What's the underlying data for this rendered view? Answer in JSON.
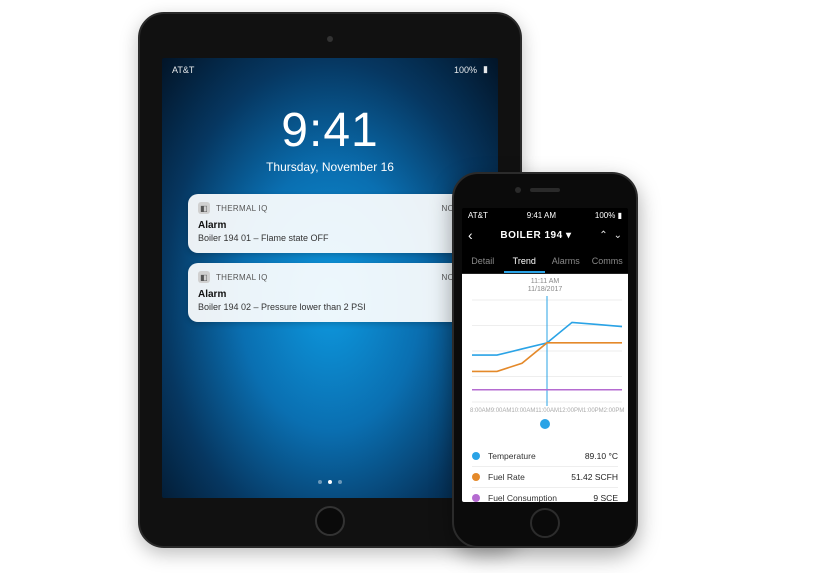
{
  "ipad": {
    "status_carrier": "AT&T",
    "status_battery": "100%",
    "clock_time": "9:41",
    "clock_date": "Thursday, November 16",
    "notifications": [
      {
        "app": "THERMAL IQ",
        "when": "now",
        "title": "Alarm",
        "body": "Boiler 194 01 – Flame state OFF"
      },
      {
        "app": "THERMAL IQ",
        "when": "now",
        "title": "Alarm",
        "body": "Boiler 194 02 – Pressure lower than 2 PSI"
      }
    ]
  },
  "phone": {
    "status_carrier": "AT&T",
    "status_time": "9:41 AM",
    "status_battery": "100%",
    "title": "BOILER 194",
    "tabs": [
      "Detail",
      "Trend",
      "Alarms",
      "Comms"
    ],
    "active_tab": "Trend",
    "timestamp_time": "11:11 AM",
    "timestamp_date": "11/18/2017",
    "xticks": [
      "8:00AM",
      "9:00AM",
      "10:00AM",
      "11:00AM",
      "12:00PM",
      "1:00PM",
      "2:00PM"
    ],
    "legend": [
      {
        "name": "Temperature",
        "value": "89.10 °C",
        "color": "#2aa3e6"
      },
      {
        "name": "Fuel Rate",
        "value": "51.42 SCFH",
        "color": "#e4892a"
      },
      {
        "name": "Fuel Consumption",
        "value": "9 SCE",
        "color": "#b56bd1"
      }
    ]
  },
  "chart_data": {
    "type": "line",
    "x": [
      0,
      1,
      2,
      3,
      4,
      5,
      6
    ],
    "xticks": [
      "8:00AM",
      "9:00AM",
      "10:00AM",
      "11:00AM",
      "12:00PM",
      "1:00PM",
      "2:00PM"
    ],
    "series": [
      {
        "name": "Temperature",
        "color": "#2aa3e6",
        "values": [
          46,
          46,
          52,
          58,
          78,
          76,
          74
        ]
      },
      {
        "name": "Fuel Rate",
        "color": "#e4892a",
        "values": [
          30,
          30,
          38,
          58,
          58,
          58,
          58
        ]
      },
      {
        "name": "Fuel Consumption",
        "color": "#b56bd1",
        "values": [
          12,
          12,
          12,
          12,
          12,
          12,
          12
        ]
      }
    ],
    "ylim": [
      0,
      100
    ],
    "marker_x": 3
  }
}
